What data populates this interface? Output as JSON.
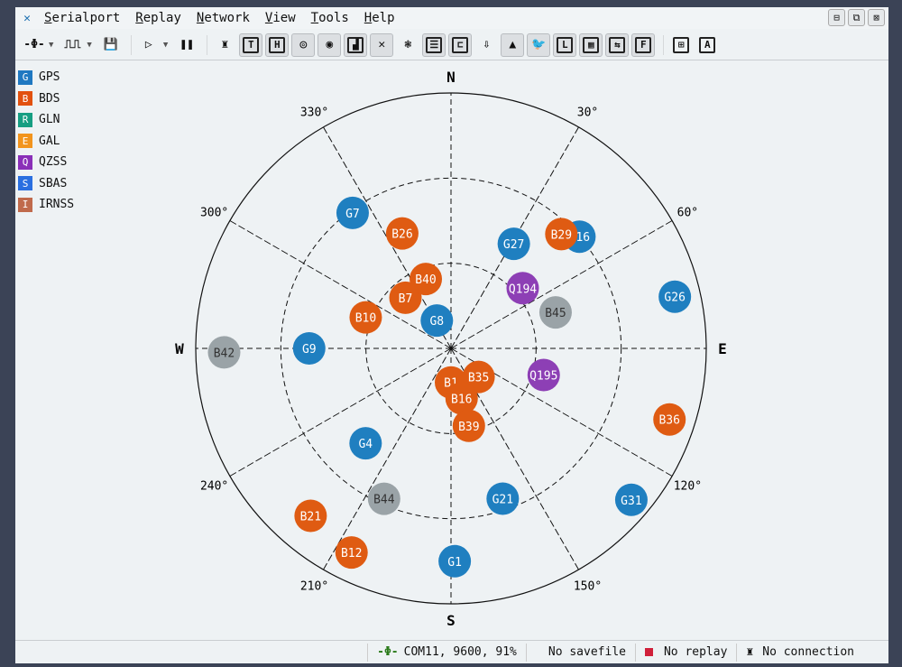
{
  "menu": [
    "Serialport",
    "Replay",
    "Network",
    "View",
    "Tools",
    "Help"
  ],
  "window_buttons": [
    "minimize",
    "restore",
    "close"
  ],
  "toolbar": [
    {
      "name": "serial-connect-icon",
      "glyph": "-Φ-",
      "dd": true
    },
    {
      "name": "signal-icon",
      "glyph": "⎍⎍",
      "dd": true
    },
    {
      "name": "save-icon",
      "glyph": "💾"
    },
    {
      "name": "sep"
    },
    {
      "name": "play-icon",
      "glyph": "▷",
      "dd": true
    },
    {
      "name": "pause-icon",
      "glyph": "❚❚"
    },
    {
      "name": "sep"
    },
    {
      "name": "network-icon",
      "glyph": "♜"
    },
    {
      "name": "text-view-icon",
      "glyph": "T",
      "box": true,
      "pressed": true
    },
    {
      "name": "hex-view-icon",
      "glyph": "H",
      "box": true,
      "pressed": true
    },
    {
      "name": "compass-icon",
      "glyph": "◎",
      "pressed": true
    },
    {
      "name": "target-icon",
      "glyph": "◉",
      "pressed": true
    },
    {
      "name": "bar-chart-icon",
      "glyph": "▟",
      "box": true,
      "pressed": true
    },
    {
      "name": "satellite-icon",
      "glyph": "✕",
      "pressed": true
    },
    {
      "name": "settings-icon",
      "glyph": "❃"
    },
    {
      "name": "list-icon",
      "glyph": "☰",
      "box": true,
      "pressed": true
    },
    {
      "name": "tree-icon",
      "glyph": "⊏",
      "box": true,
      "pressed": true
    },
    {
      "name": "download-icon",
      "glyph": "⇩"
    },
    {
      "name": "navigation-icon",
      "glyph": "▲",
      "pressed": true
    },
    {
      "name": "bird-icon",
      "glyph": "🐦",
      "pressed": true
    },
    {
      "name": "clock-icon",
      "glyph": "L",
      "box": true,
      "pressed": true
    },
    {
      "name": "grid-icon",
      "glyph": "▦",
      "box": true,
      "pressed": true
    },
    {
      "name": "swap-icon",
      "glyph": "⇆",
      "box": true,
      "pressed": true
    },
    {
      "name": "file-icon",
      "glyph": "F",
      "box": true,
      "pressed": true
    },
    {
      "name": "sep"
    },
    {
      "name": "layout-icon",
      "glyph": "⊞",
      "box": true
    },
    {
      "name": "a-icon",
      "glyph": "A",
      "box": true
    }
  ],
  "legend": [
    {
      "letter": "G",
      "name": "GPS",
      "color": "#1f78c1"
    },
    {
      "letter": "B",
      "name": "BDS",
      "color": "#e2510f"
    },
    {
      "letter": "R",
      "name": "GLN",
      "color": "#169e82"
    },
    {
      "letter": "E",
      "name": "GAL",
      "color": "#f2941d"
    },
    {
      "letter": "Q",
      "name": "QZSS",
      "color": "#8a2fb8"
    },
    {
      "letter": "S",
      "name": "SBAS",
      "color": "#2a6fe0"
    },
    {
      "letter": "I",
      "name": "IRNSS",
      "color": "#c06a4c"
    }
  ],
  "skyplot": {
    "cardinals": {
      "N": "N",
      "E": "E",
      "S": "S",
      "W": "W"
    },
    "azimuth_labels": [
      "30°",
      "60°",
      "120°",
      "150°",
      "210°",
      "240°",
      "300°",
      "330°"
    ],
    "satellites": [
      {
        "id": "G7",
        "az": 324,
        "el": 31,
        "color": "#1f7fc0"
      },
      {
        "id": "B26",
        "az": 337,
        "el": 46,
        "color": "#df5b12"
      },
      {
        "id": "G16",
        "az": 49,
        "el": 30,
        "color": "#1f7fc0"
      },
      {
        "id": "B29",
        "az": 44,
        "el": 34,
        "color": "#df5b12"
      },
      {
        "id": "G27",
        "az": 31,
        "el": 47,
        "color": "#1f7fc0"
      },
      {
        "id": "B10",
        "az": 290,
        "el": 58,
        "color": "#df5b12"
      },
      {
        "id": "G8",
        "az": 333,
        "el": 79,
        "color": "#1f7fc0"
      },
      {
        "id": "B7",
        "az": 318,
        "el": 66,
        "color": "#df5b12"
      },
      {
        "id": "B40",
        "az": 340,
        "el": 64,
        "color": "#df5b12"
      },
      {
        "id": "Q194",
        "az": 50,
        "el": 57,
        "color": "#8d3fb5"
      },
      {
        "id": "B45",
        "az": 71,
        "el": 51,
        "color": "#9aa3a7"
      },
      {
        "id": "G26",
        "az": 77,
        "el": 9,
        "color": "#1f7fc0"
      },
      {
        "id": "B42",
        "az": 269,
        "el": 10,
        "color": "#9aa3a7"
      },
      {
        "id": "G9",
        "az": 270,
        "el": 40,
        "color": "#1f7fc0"
      },
      {
        "id": "Q195",
        "az": 106,
        "el": 56,
        "color": "#8d3fb5"
      },
      {
        "id": "B1",
        "az": 180,
        "el": 78,
        "color": "#df5b12"
      },
      {
        "id": "B35",
        "az": 136,
        "el": 76,
        "color": "#df5b12"
      },
      {
        "id": "B16",
        "az": 168,
        "el": 72,
        "color": "#df5b12"
      },
      {
        "id": "B39",
        "az": 167,
        "el": 62,
        "color": "#df5b12"
      },
      {
        "id": "B36",
        "az": 108,
        "el": 9,
        "color": "#df5b12"
      },
      {
        "id": "G4",
        "az": 222,
        "el": 45,
        "color": "#1f7fc0"
      },
      {
        "id": "G21",
        "az": 161,
        "el": 34,
        "color": "#1f7fc0"
      },
      {
        "id": "G31",
        "az": 130,
        "el": 7,
        "color": "#1f7fc0"
      },
      {
        "id": "B44",
        "az": 204,
        "el": 32,
        "color": "#9aa3a7"
      },
      {
        "id": "B21",
        "az": 220,
        "el": 13,
        "color": "#df5b12"
      },
      {
        "id": "B12",
        "az": 206,
        "el": 10,
        "color": "#df5b12"
      },
      {
        "id": "G1",
        "az": 179,
        "el": 15,
        "color": "#1f7fc0"
      }
    ]
  },
  "status": {
    "serial": "COM11, 9600, 91%",
    "savefile": "No savefile",
    "replay": "No replay",
    "connection": "No connection",
    "replay_color": "#d0203a"
  }
}
